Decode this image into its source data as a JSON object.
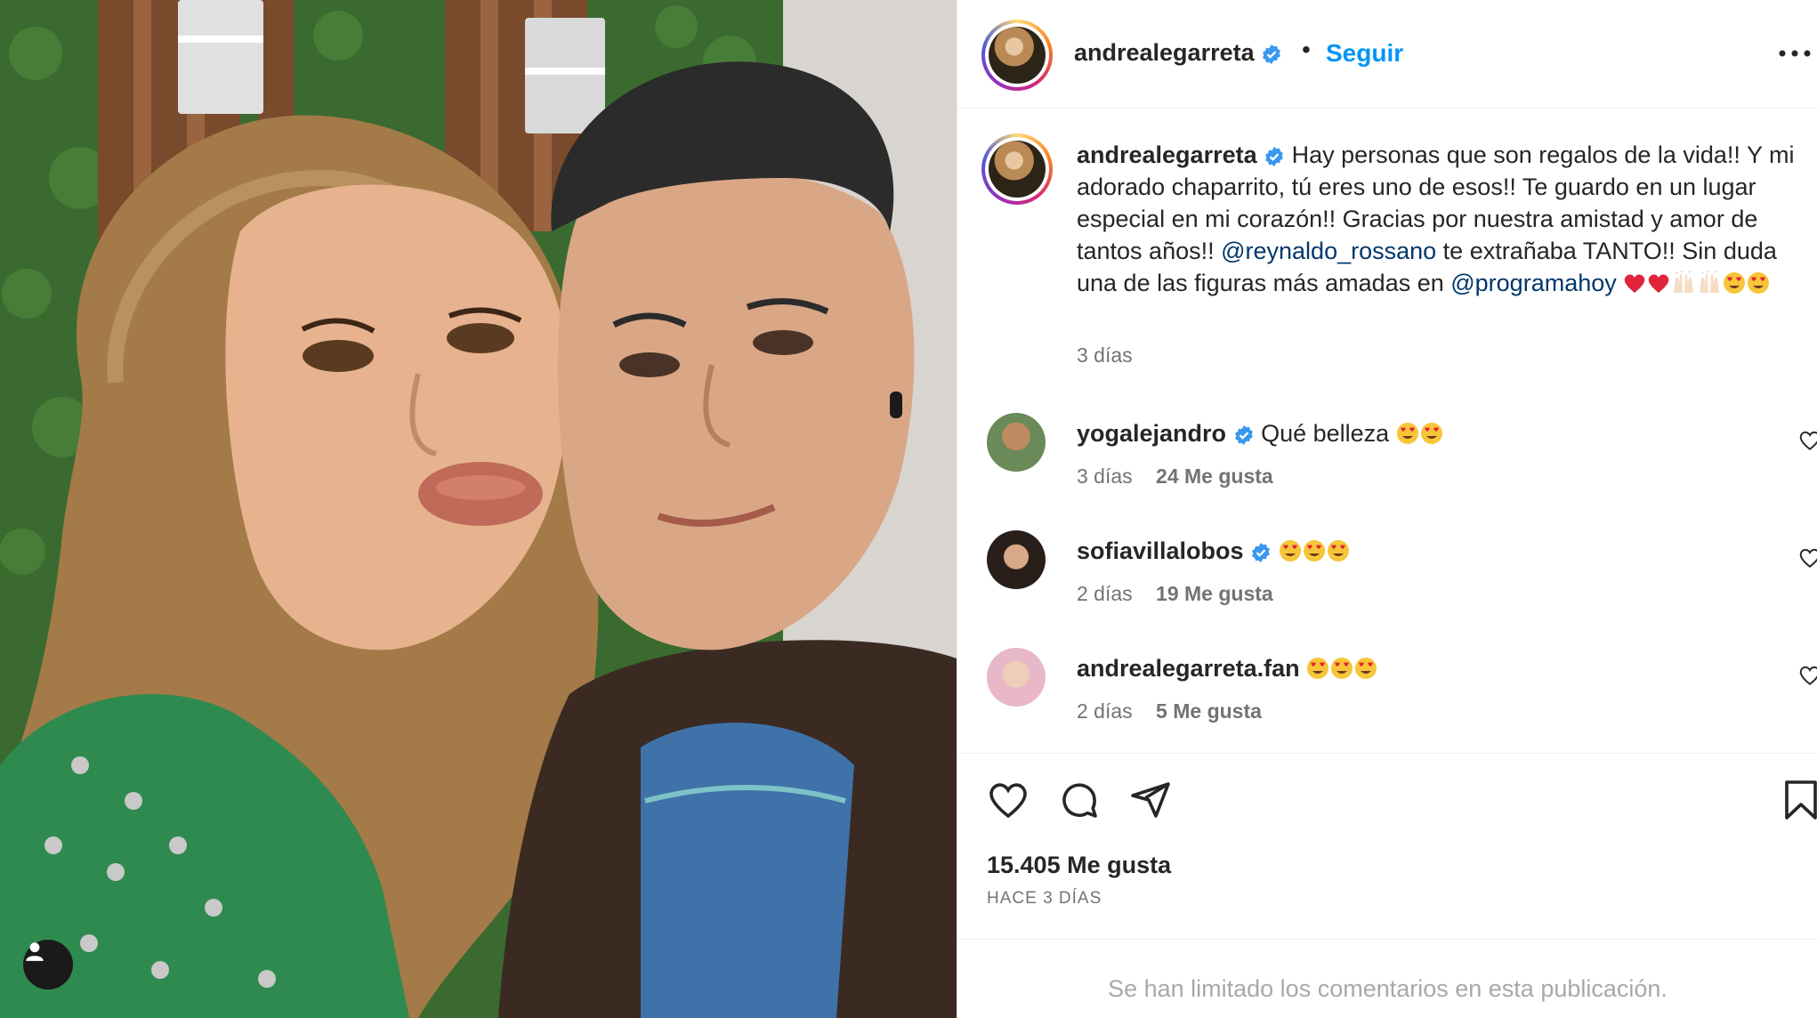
{
  "post": {
    "author": "andrealegarreta",
    "follow_label": "Seguir",
    "separator": "•",
    "caption_user": "andrealegarreta",
    "caption_p1": " Hay personas que son regalos de la vida!! Y mi adorado chaparrito, tú eres uno de esos!! Te guardo en un lugar especial en mi corazón!! Gracias por nuestra amistad y amor de tantos años!! ",
    "caption_mention1": "@reynaldo_rossano",
    "caption_p2": " te extrañaba TANTO!! Sin duda una de las figuras más amadas en ",
    "caption_mention2": "@programahoy",
    "caption_time": "3 días"
  },
  "comments": [
    {
      "user": "yogalejandro",
      "text": "Qué belleza",
      "time": "3 días",
      "likes": "24 Me gusta"
    },
    {
      "user": "sofiavillalobos",
      "text": "",
      "time": "2 días",
      "likes": "19 Me gusta"
    },
    {
      "user": "andrealegarreta.fan",
      "text": "",
      "time": "2 días",
      "likes": "5 Me gusta"
    }
  ],
  "footer": {
    "likes": "15.405 Me gusta",
    "time_ago": "HACE 3 DÍAS",
    "limited_notice": "Se han limitado los comentarios en esta publicación."
  },
  "icons": {
    "verified": "verified-badge-icon",
    "like": "heart-icon",
    "comment": "comment-bubble-icon",
    "share": "paper-plane-icon",
    "save": "bookmark-icon",
    "more": "ellipsis-icon",
    "user_tag": "person-icon"
  },
  "colors": {
    "link_blue": "#0095f6",
    "mention_blue": "#00376b",
    "verified_blue": "#3897f0",
    "muted_text": "#737373"
  }
}
